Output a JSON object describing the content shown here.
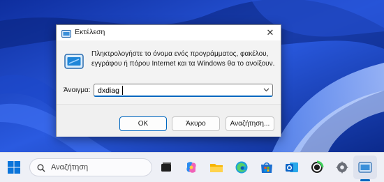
{
  "dialog": {
    "title": "Εκτέλεση",
    "close_glyph": "✕",
    "description": "Πληκτρολογήστε το όνομα ενός προγράμματος, φακέλου, εγγράφου ή πόρου Internet και τα Windows θα το ανοίξουν.",
    "open_label": "Άνοιγμα:",
    "open_value": "dxdiag",
    "ok_label": "OK",
    "cancel_label": "Άκυρο",
    "browse_label": "Αναζήτηση..."
  },
  "taskbar": {
    "search_placeholder": "Αναζήτηση",
    "icons": [
      "start-icon",
      "task-view-icon",
      "copilot-icon",
      "file-explorer-icon",
      "edge-icon",
      "store-icon",
      "outlook-icon",
      "xbox-icon",
      "settings-icon",
      "run-app-icon"
    ]
  },
  "colors": {
    "accent": "#0067c0",
    "wallpaper": "#1b3fb8"
  }
}
